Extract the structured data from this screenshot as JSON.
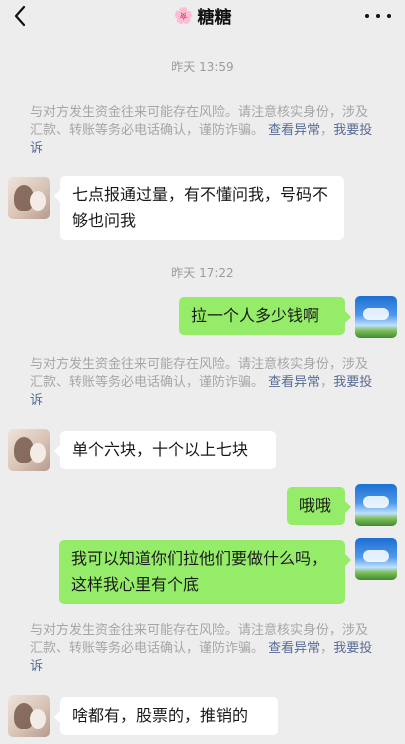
{
  "header": {
    "title_emoji": "🌸",
    "title": "糖糖"
  },
  "timestamps": [
    "昨天 13:59",
    "昨天 17:22"
  ],
  "notice": {
    "text": "与对方发生资金往来可能存在风险。请注意核实身份，涉及汇款、转账等务必电话确认，谨防诈骗。",
    "link_view": "查看异常",
    "separator": "，",
    "link_report": "我要投诉"
  },
  "messages": [
    {
      "side": "left",
      "text": "七点报通过量，有不懂问我，号码不够也问我"
    },
    {
      "side": "right",
      "text": "拉一个人多少钱啊"
    },
    {
      "side": "left",
      "text": "单个六块，十个以上七块"
    },
    {
      "side": "right",
      "text": "哦哦"
    },
    {
      "side": "right",
      "text": "我可以知道你们拉他们要做什么吗，这样我心里有个底"
    },
    {
      "side": "left",
      "text": "啥都有，股票的，推销的"
    }
  ],
  "colors": {
    "background": "#EDEDED",
    "bubble_self": "#95EC69",
    "bubble_other": "#FFFFFF",
    "link": "#576B95"
  },
  "icons": {
    "back": "chevron-left-icon",
    "more": "more-dots-icon"
  }
}
